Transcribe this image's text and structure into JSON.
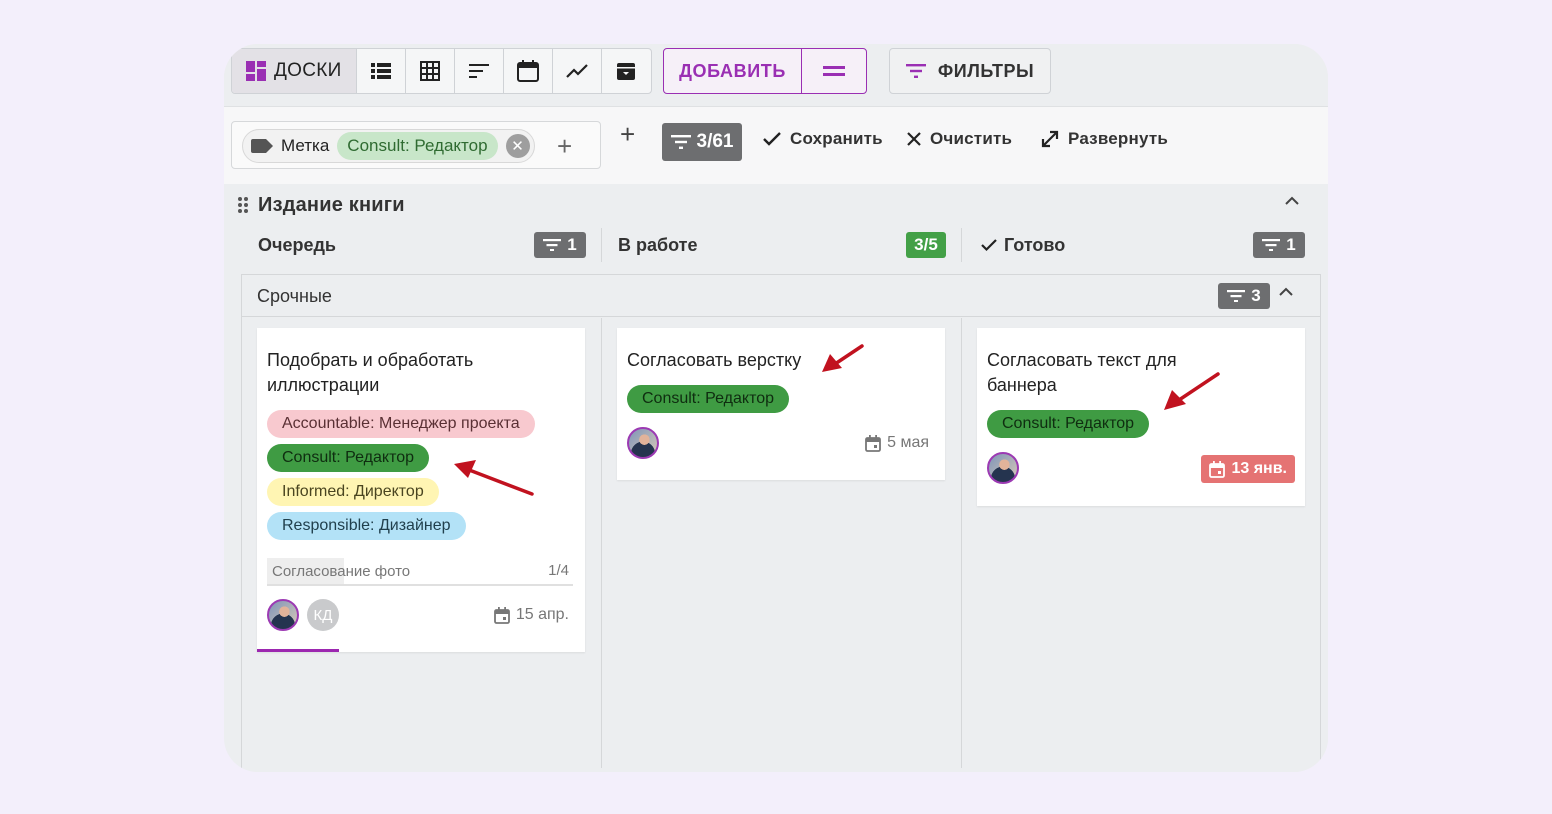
{
  "toolbar": {
    "boards_label": "ДОСКИ",
    "add_label": "ДОБАВИТЬ",
    "filters_label": "ФИЛЬТРЫ"
  },
  "filter_bar": {
    "label_name": "Метка",
    "label_value": "Consult: Редактор",
    "counter": "3/61",
    "save": "Сохранить",
    "clear": "Очистить",
    "expand": "Развернуть"
  },
  "board": {
    "title": "Издание книги",
    "columns": [
      {
        "name": "Очередь",
        "badge": "1"
      },
      {
        "name": "В работе",
        "badge": "3/5"
      },
      {
        "name": "Готово",
        "badge": "1"
      }
    ],
    "swimlane": {
      "title": "Срочные",
      "badge": "3"
    }
  },
  "cards": [
    {
      "title": "Подобрать и обработать иллюстрации",
      "tags": [
        "Accountable: Менеджер проекта",
        "Consult: Редактор",
        "Informed: Директор",
        "Responsible: Дизайнер"
      ],
      "checklist": {
        "name": "Согласование фото",
        "count": "1/4",
        "progress": 0.25
      },
      "avatar2": "КД",
      "due": "15 апр."
    },
    {
      "title": "Согласовать верстку",
      "tags": [
        "Consult: Редактор"
      ],
      "due": "5 мая"
    },
    {
      "title": "Согласовать текст для баннера",
      "tags": [
        "Consult: Редактор"
      ],
      "due": "13 янв."
    }
  ],
  "colors": {
    "accent": "#9a2fb3",
    "tag_green": "#3f9b43",
    "due_overdue": "#e57373",
    "badge_gray": "#6d6e70"
  }
}
